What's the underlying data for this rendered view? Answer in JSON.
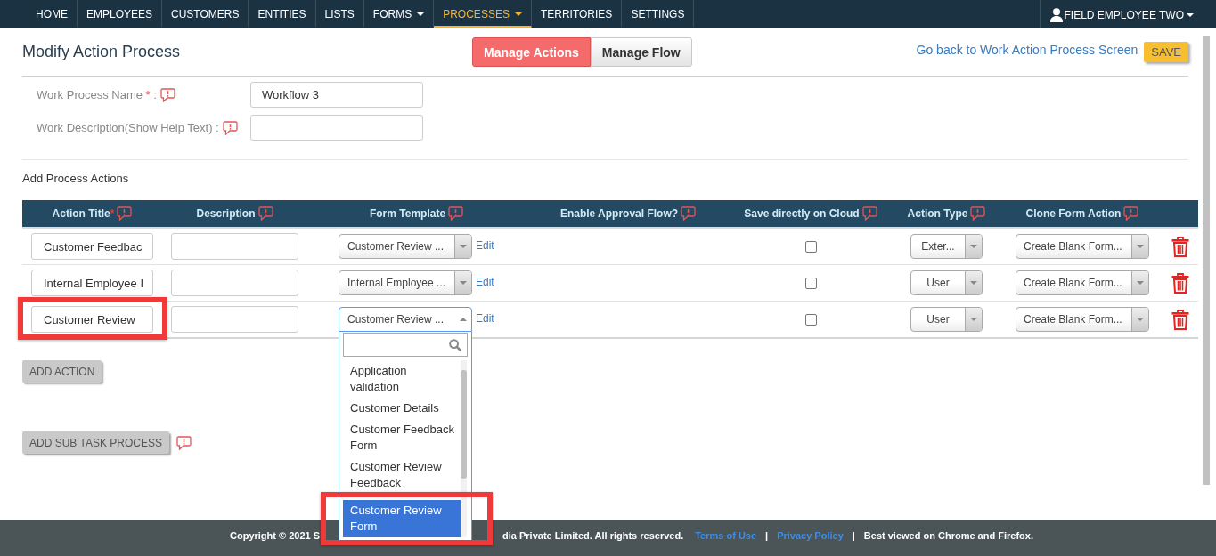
{
  "nav": {
    "items": [
      {
        "label": "HOME",
        "selected": false,
        "has_menu": false
      },
      {
        "label": "EMPLOYEES",
        "selected": false,
        "has_menu": false
      },
      {
        "label": "CUSTOMERS",
        "selected": false,
        "has_menu": false
      },
      {
        "label": "ENTITIES",
        "selected": false,
        "has_menu": false
      },
      {
        "label": "LISTS",
        "selected": false,
        "has_menu": false
      },
      {
        "label": "FORMS",
        "selected": false,
        "has_menu": true
      },
      {
        "label": "PROCESSES",
        "selected": true,
        "has_menu": true
      },
      {
        "label": "TERRITORIES",
        "selected": false,
        "has_menu": false
      },
      {
        "label": "SETTINGS",
        "selected": false,
        "has_menu": false
      }
    ],
    "user": {
      "name": "FIELD EMPLOYEE TWO"
    }
  },
  "header": {
    "title": "Modify Action Process",
    "view_tabs": [
      {
        "label": "Manage Actions",
        "selected": true
      },
      {
        "label": "Manage Flow",
        "selected": false
      }
    ],
    "back_link": "Go back to Work Action Process Screen",
    "save_button": "SAVE"
  },
  "process_fields": [
    {
      "label": "Work Process Name",
      "required_mark": "*",
      "colon": ":",
      "value": "Workflow 3"
    },
    {
      "label": "Work Description(Show Help Text)",
      "colon": ":"
    }
  ],
  "actions": {
    "title": "Add Process Actions",
    "columns": [
      {
        "label": "Action Title",
        "required_mark": "*"
      },
      {
        "label": "Description"
      },
      {
        "label": "Form Template"
      },
      {
        "label": "Enable Approval Flow?"
      },
      {
        "label": "Save directly on Cloud"
      },
      {
        "label": "Action Type"
      },
      {
        "label": "Clone Form Action"
      }
    ],
    "rows": [
      {
        "title": "Customer Feedbac",
        "title_highlighted": false,
        "form_template": "Customer Review ...",
        "template_expanded": false,
        "edit_link": "Edit",
        "save_on_cloud": false,
        "action_type": "Exter...",
        "clone_action": "Create Blank Form..."
      },
      {
        "title": "Internal Employee I",
        "title_highlighted": false,
        "form_template": "Internal Employee ...",
        "template_expanded": false,
        "edit_link": "Edit",
        "save_on_cloud": false,
        "action_type": "User",
        "clone_action": "Create Blank Form..."
      },
      {
        "title": "Customer Review",
        "title_highlighted": true,
        "form_template": "Customer Review ...",
        "template_expanded": true,
        "template_options": [
          {
            "label": "Application validation",
            "selected": false,
            "highlighted": false
          },
          {
            "label": "Customer Details",
            "selected": false,
            "highlighted": false
          },
          {
            "label": "Customer Feedback Form",
            "selected": false,
            "highlighted": false
          },
          {
            "label": "Customer Review Feedback",
            "selected": false,
            "highlighted": false
          },
          {
            "label": "Customer Review Form",
            "selected": true,
            "highlighted": true
          }
        ],
        "edit_link": "Edit",
        "save_on_cloud": false,
        "action_type": "User",
        "clone_action": "Create Blank Form..."
      }
    ]
  },
  "buttons": {
    "add_action": "ADD ACTION",
    "add_sub_task": "ADD SUB TASK PROCESS"
  },
  "footer": [
    {
      "kind": "text",
      "text": "Copyright © 2021 S"
    },
    {
      "kind": "text",
      "text": "dia Private Limited. All rights reserved."
    },
    {
      "kind": "link",
      "text": "Terms of Use"
    },
    {
      "kind": "separator",
      "text": "|"
    },
    {
      "kind": "link",
      "text": "Privacy Policy"
    },
    {
      "kind": "separator",
      "text": "|"
    },
    {
      "kind": "text",
      "text": "Best viewed on Chrome and Firefox."
    }
  ]
}
